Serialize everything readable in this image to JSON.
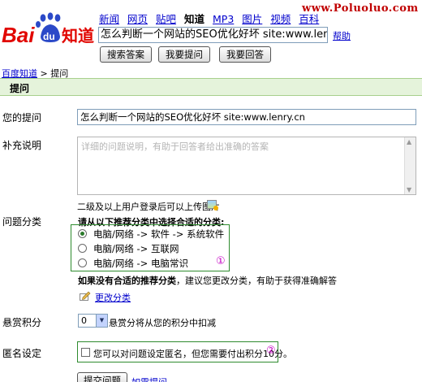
{
  "watermark": "www.Poluoluo.com",
  "brand": {
    "bai": "Bai",
    "du": "du",
    "zhidao": "知道",
    "primary_color": "#e10600",
    "paw_color": "#2b49c8"
  },
  "nav": {
    "items": [
      "新闻",
      "网页",
      "贴吧",
      "知道",
      "MP3",
      "图片",
      "视频",
      "百科"
    ],
    "active": "知道"
  },
  "search": {
    "value": "怎么判断一个网站的SEO优化好坏 site:www.lenry.cn",
    "help_label": "帮助"
  },
  "buttons": {
    "search_answer": "搜索答案",
    "ask": "我要提问",
    "answer": "我要回答"
  },
  "breadcrumb": {
    "home": "百度知道",
    "separator": " > ",
    "current": "提问"
  },
  "section_title": "提问",
  "question": {
    "label": "您的提问",
    "value": "怎么判断一个网站的SEO优化好坏 site:www.lenry.cn"
  },
  "supplement": {
    "label": "补充说明",
    "placeholder": "详细的问题说明，有助于回答者给出准确的答案"
  },
  "upload_note": "二级及以上用户登录后可以上传图片",
  "category": {
    "label": "问题分类",
    "heading": "请从以下推荐分类中选择合适的分类:",
    "options": [
      "电脑/网络 -> 软件 -> 系统软件",
      "电脑/网络 -> 互联网",
      "电脑/网络 -> 电脑常识"
    ],
    "selected_index": 0,
    "marker": "①",
    "hint_bold": "如果没有合适的推荐分类",
    "hint_rest": "，建议您更改分类，有助于获得准确解答",
    "change_label": "更改分类"
  },
  "reward": {
    "label": "悬赏积分",
    "value": "0",
    "note": "悬赏分将从您的积分中扣减"
  },
  "anonymous": {
    "label": "匿名设定",
    "text": "您可以对问题设定匿名，但您需要付出积分10分。",
    "marker": "②",
    "checked": false
  },
  "submit": {
    "label": "提交问题",
    "link": "如需提问"
  }
}
